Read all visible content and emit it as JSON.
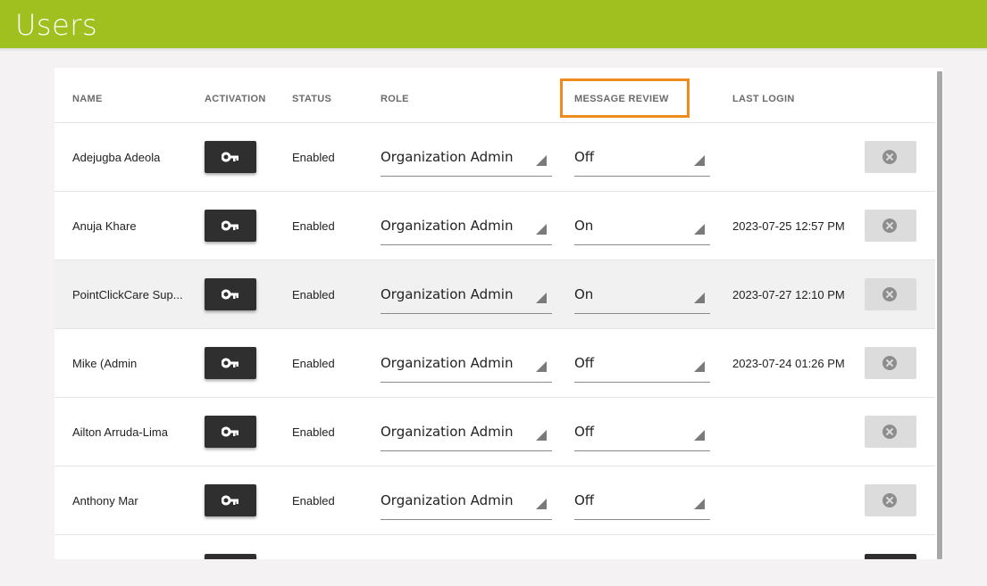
{
  "header": {
    "title": "Users"
  },
  "table": {
    "columns": {
      "name": "NAME",
      "activation": "ACTIVATION",
      "status": "STATUS",
      "role": "ROLE",
      "message_review": "MESSAGE REVIEW",
      "last_login": "LAST LOGIN"
    },
    "rows": [
      {
        "name": "Adejugba Adeola",
        "status": "Enabled",
        "role": "Organization Admin",
        "message_review": "Off",
        "last_login": ""
      },
      {
        "name": "Anuja Khare",
        "status": "Enabled",
        "role": "Organization Admin",
        "message_review": "On",
        "last_login": "2023-07-25 12:57 PM"
      },
      {
        "name": "PointClickCare Sup...",
        "status": "Enabled",
        "role": "Organization Admin",
        "message_review": "On",
        "last_login": "2023-07-27 12:10 PM"
      },
      {
        "name": "Mike (Admin",
        "status": "Enabled",
        "role": "Organization Admin",
        "message_review": "Off",
        "last_login": "2023-07-24 01:26 PM"
      },
      {
        "name": "Ailton Arruda-Lima",
        "status": "Enabled",
        "role": "Organization Admin",
        "message_review": "Off",
        "last_login": ""
      },
      {
        "name": "Anthony Mar",
        "status": "Enabled",
        "role": "Organization Admin",
        "message_review": "Off",
        "last_login": ""
      }
    ]
  },
  "icons": {
    "activation": "key-icon",
    "delete": "close-circle-icon"
  },
  "colors": {
    "topbar": "#9fc01f",
    "highlight": "#ef8a1c",
    "button_dark": "#2f2f2f",
    "button_light": "#dcdcdc"
  }
}
